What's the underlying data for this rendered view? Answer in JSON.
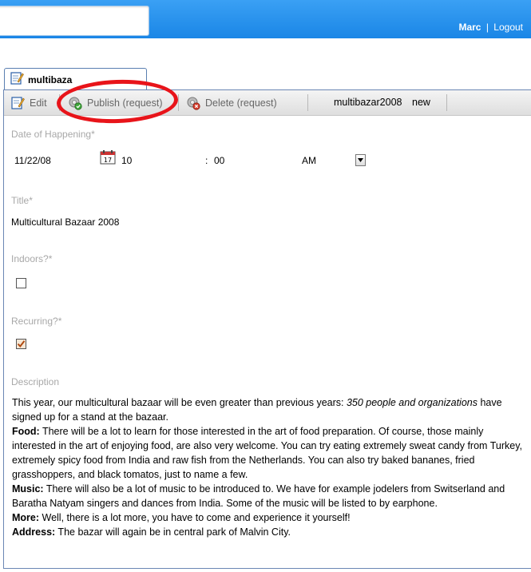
{
  "header": {
    "user": "Marc",
    "separator": "|",
    "logout": "Logout"
  },
  "tab": {
    "title": "multibaza"
  },
  "toolbar": {
    "edit": "Edit",
    "publish": "Publish (request)",
    "delete": "Delete (request)",
    "item_id": "multibazar2008",
    "item_status": "new"
  },
  "form": {
    "date_label": "Date of Happening*",
    "date_value": "11/22/08",
    "hour": "10",
    "time_sep": ":",
    "minute": "00",
    "ampm": "AM",
    "title_label": "Title*",
    "title_value": "Multicultural Bazaar 2008",
    "indoors_label": "Indoors?*",
    "indoors_checked": false,
    "recurring_label": "Recurring?*",
    "recurring_checked": true,
    "description_label": "Description"
  },
  "description": {
    "intro": "This year, our multicultural bazaar will be even greater than previous years: ",
    "intro_em": "350 people and organizations",
    "intro_end": "have signed up for a stand at the bazaar.",
    "food_label": "Food:",
    "food_text": " There will be a lot to learn for those interested in the art of food preparation. Of course, those mainly interested in the art of enjoying food, are also very welcome. You can try eating extremely sweat candy from Turkey, extremely spicy food from India and raw fish from the Netherlands. You can also try baked bananes, fried grasshoppers, and black tomatos, just to name a few.",
    "music_label": "Music:",
    "music_text": " There will also be a lot of music to be introduced to. We have for example jodelers from Switserland and Baratha Natyam singers and dances from India. Some of the music will be listed to by earphone.",
    "more_label": "More:",
    "more_text": " Well, there is a lot more, you have to come and experience it yourself!",
    "address_label": "Address:",
    "address_text": " The bazar will again be in central park of Malvin City."
  },
  "colors": {
    "header_blue": "#1a86e6",
    "annotation_red": "#e8141a"
  }
}
